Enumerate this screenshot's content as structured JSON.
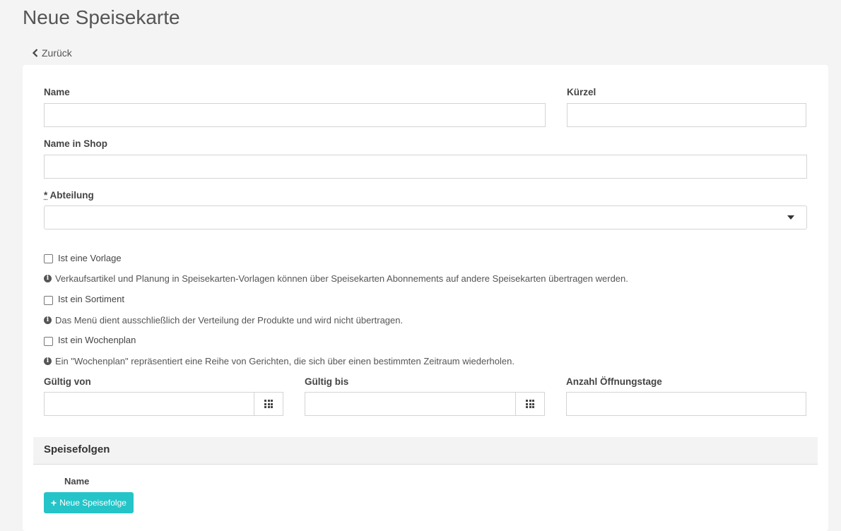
{
  "page": {
    "title": "Neue Speisekarte",
    "back_label": "Zurück"
  },
  "form": {
    "name": {
      "label": "Name",
      "value": ""
    },
    "kuerzel": {
      "label": "Kürzel",
      "value": ""
    },
    "name_in_shop": {
      "label": "Name in Shop",
      "value": ""
    },
    "abteilung": {
      "required_mark": "*",
      "label": "Abteilung",
      "value": ""
    },
    "ist_vorlage": {
      "label": "Ist eine Vorlage",
      "checked": false,
      "info": "Verkaufsartikel und Planung in Speisekarten-Vorlagen können über Speisekarten Abonnements auf andere Speisekarten übertragen werden."
    },
    "ist_sortiment": {
      "label": "Ist ein Sortiment",
      "checked": false,
      "info": "Das Menü dient ausschließlich der Verteilung der Produkte und wird nicht übertragen."
    },
    "ist_wochenplan": {
      "label": "Ist ein Wochenplan",
      "checked": false,
      "info": "Ein \"Wochenplan\" repräsentiert eine Reihe von Gerichten, die sich über einen bestimmten Zeitraum wiederholen."
    },
    "gueltig_von": {
      "label": "Gültig von",
      "value": ""
    },
    "gueltig_bis": {
      "label": "Gültig bis",
      "value": ""
    },
    "oeffnungstage": {
      "label": "Anzahl Öffnungstage",
      "value": ""
    }
  },
  "speisefolgen": {
    "title": "Speisefolgen",
    "column_name": "Name",
    "add_button": "Neue Speisefolge"
  },
  "colors": {
    "accent": "#25c4c8",
    "background": "#f3f4f3"
  },
  "icons": [
    "chevron-left-icon",
    "caret-down-icon",
    "info-circle-icon",
    "calendar-grid-icon",
    "plus-icon"
  ]
}
